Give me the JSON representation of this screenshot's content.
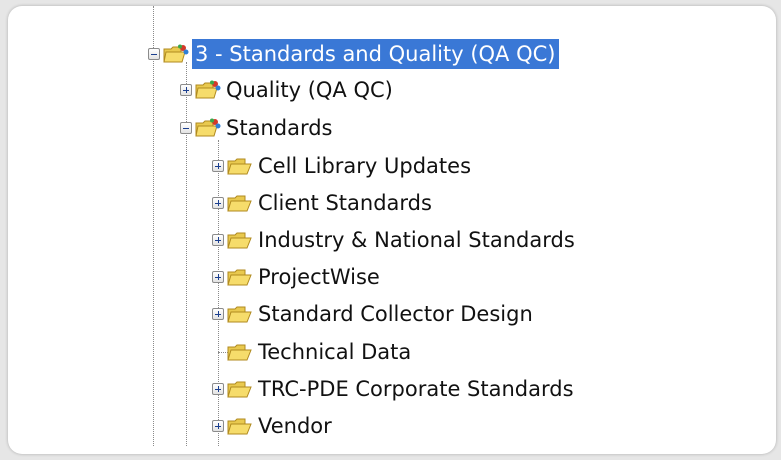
{
  "tree": {
    "root": {
      "label": "3 - Standards and Quality (QA QC)",
      "icon": "special-folder-icon",
      "selected": true,
      "expanded": true
    },
    "level1": [
      {
        "label": "Quality (QA QC)",
        "icon": "special-folder-icon",
        "expanded": false
      },
      {
        "label": "Standards",
        "icon": "special-folder-icon",
        "expanded": true
      }
    ],
    "standards_children": [
      {
        "label": "Cell Library Updates",
        "icon": "folder-icon",
        "has_children": true
      },
      {
        "label": "Client Standards",
        "icon": "folder-icon",
        "has_children": true
      },
      {
        "label": "Industry & National Standards",
        "icon": "folder-icon",
        "has_children": true
      },
      {
        "label": "ProjectWise",
        "icon": "folder-icon",
        "has_children": true
      },
      {
        "label": "Standard Collector Design",
        "icon": "folder-icon",
        "has_children": true
      },
      {
        "label": "Technical Data",
        "icon": "folder-icon",
        "has_children": false
      },
      {
        "label": "TRC-PDE Corporate Standards",
        "icon": "folder-icon",
        "has_children": true
      },
      {
        "label": "Vendor",
        "icon": "folder-icon",
        "has_children": true
      }
    ]
  },
  "colors": {
    "selection": "#3a78d6",
    "folder": "#f2d25c",
    "background": "#ffffff"
  }
}
